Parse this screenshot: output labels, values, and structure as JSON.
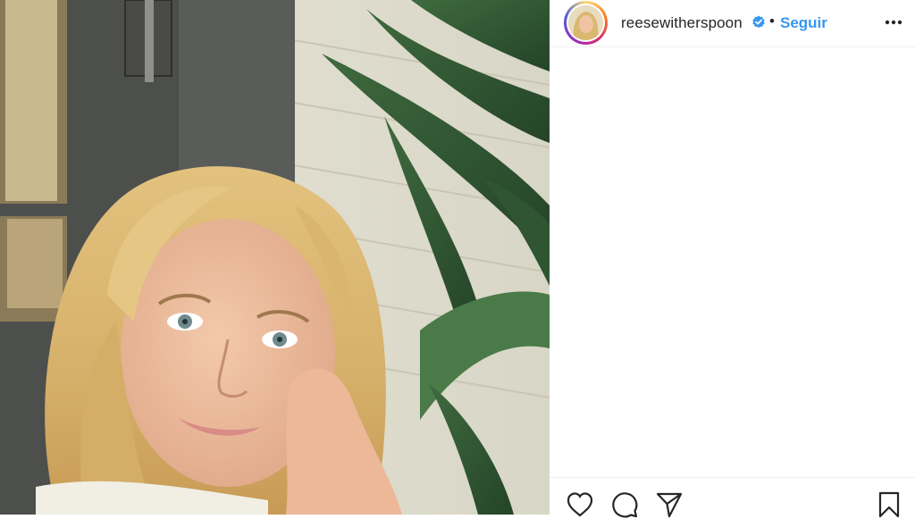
{
  "header": {
    "username": "reesewitherspoon",
    "separator": "•",
    "follow_label": "Seguir",
    "verified_icon": "verified-badge-icon",
    "more_icon": "more-options-icon"
  },
  "photo": {
    "description_icon": "selfie-photo"
  },
  "actions": {
    "like_icon": "heart-icon",
    "comment_icon": "comment-icon",
    "share_icon": "share-icon",
    "save_icon": "bookmark-icon"
  },
  "colors": {
    "follow_blue": "#3897f0",
    "verified_blue": "#3897f0",
    "text": "#262626"
  }
}
